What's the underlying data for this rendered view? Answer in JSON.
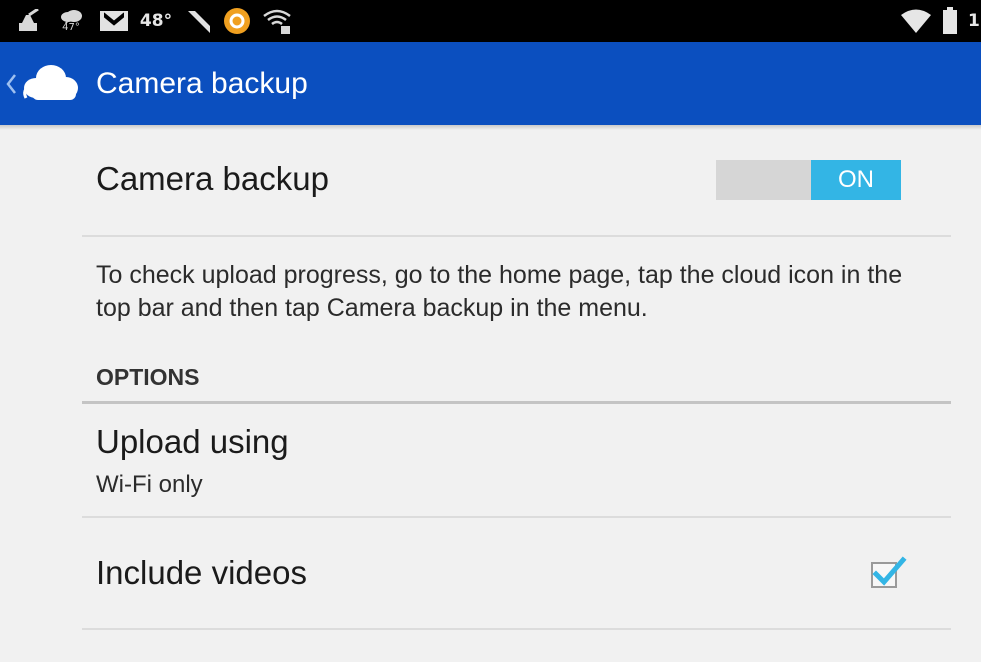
{
  "status_bar": {
    "weather_temp": "47°",
    "temperature": "48°",
    "time_partial": "1"
  },
  "app_bar": {
    "title": "Camera backup"
  },
  "camera_backup": {
    "label": "Camera backup",
    "toggle_label": "ON",
    "toggle_on": true
  },
  "help_text": "To check upload progress, go to the home page, tap the cloud icon in the top bar and then tap Camera backup in the menu.",
  "options": {
    "header": "OPTIONS",
    "upload_using": {
      "label": "Upload using",
      "value": "Wi-Fi only"
    },
    "include_videos": {
      "label": "Include videos",
      "checked": true
    }
  },
  "colors": {
    "app_bar": "#0b4fbf",
    "toggle_on": "#33b5e5",
    "check": "#33b5e5",
    "background": "#f1f1f1"
  }
}
